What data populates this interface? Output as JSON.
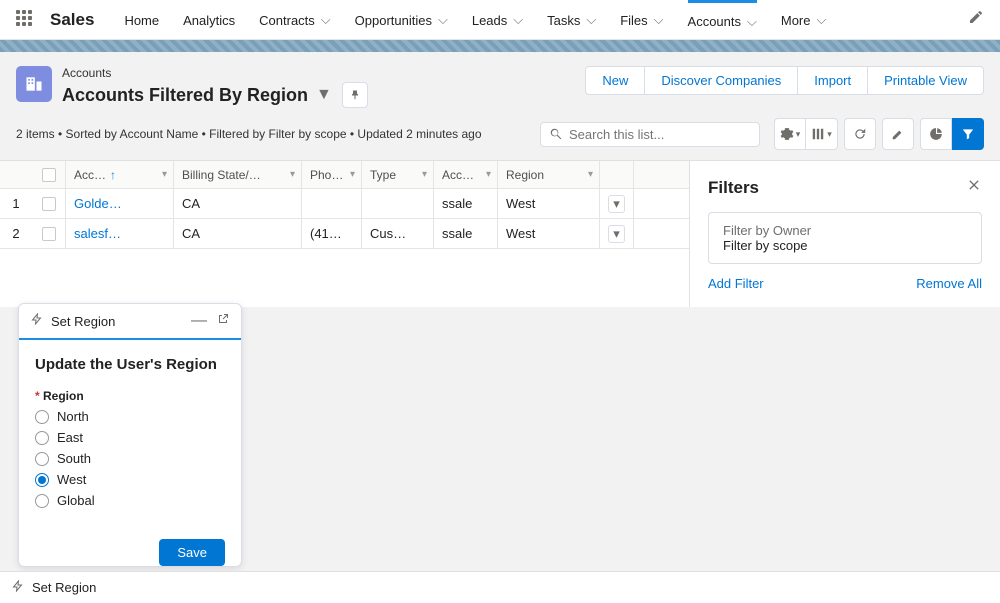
{
  "brand": "Sales",
  "nav": {
    "items": [
      {
        "label": "Home",
        "dd": false
      },
      {
        "label": "Analytics",
        "dd": false
      },
      {
        "label": "Contracts",
        "dd": true
      },
      {
        "label": "Opportunities",
        "dd": true
      },
      {
        "label": "Leads",
        "dd": true
      },
      {
        "label": "Tasks",
        "dd": true
      },
      {
        "label": "Files",
        "dd": true
      },
      {
        "label": "Accounts",
        "dd": true,
        "active": true
      },
      {
        "label": "More",
        "dd": true
      }
    ]
  },
  "header": {
    "crumb": "Accounts",
    "title": "Accounts Filtered By Region",
    "actions": [
      "New",
      "Discover Companies",
      "Import",
      "Printable View"
    ],
    "listinfo": "2 items • Sorted by Account Name • Filtered by Filter by scope • Updated 2 minutes ago",
    "search_placeholder": "Search this list..."
  },
  "table": {
    "columns": [
      "Acc…",
      "Billing State/…",
      "Pho…",
      "Type",
      "Acc…",
      "Region"
    ],
    "rows": [
      {
        "num": "1",
        "name": "Golde…",
        "state": "CA",
        "phone": "",
        "type": "",
        "acc": "ssale",
        "region": "West"
      },
      {
        "num": "2",
        "name": "salesf…",
        "state": "CA",
        "phone": "(41…",
        "type": "Cus…",
        "acc": "ssale",
        "region": "West"
      }
    ]
  },
  "filters": {
    "title": "Filters",
    "owner_label": "Filter by Owner",
    "scope_value": "Filter by scope",
    "add": "Add Filter",
    "remove": "Remove All"
  },
  "util": {
    "head": "Set Region",
    "title": "Update the User's Region",
    "field": "Region",
    "options": [
      "North",
      "East",
      "South",
      "West",
      "Global"
    ],
    "selected": "West",
    "save": "Save"
  },
  "bottom": {
    "label": "Set Region"
  }
}
